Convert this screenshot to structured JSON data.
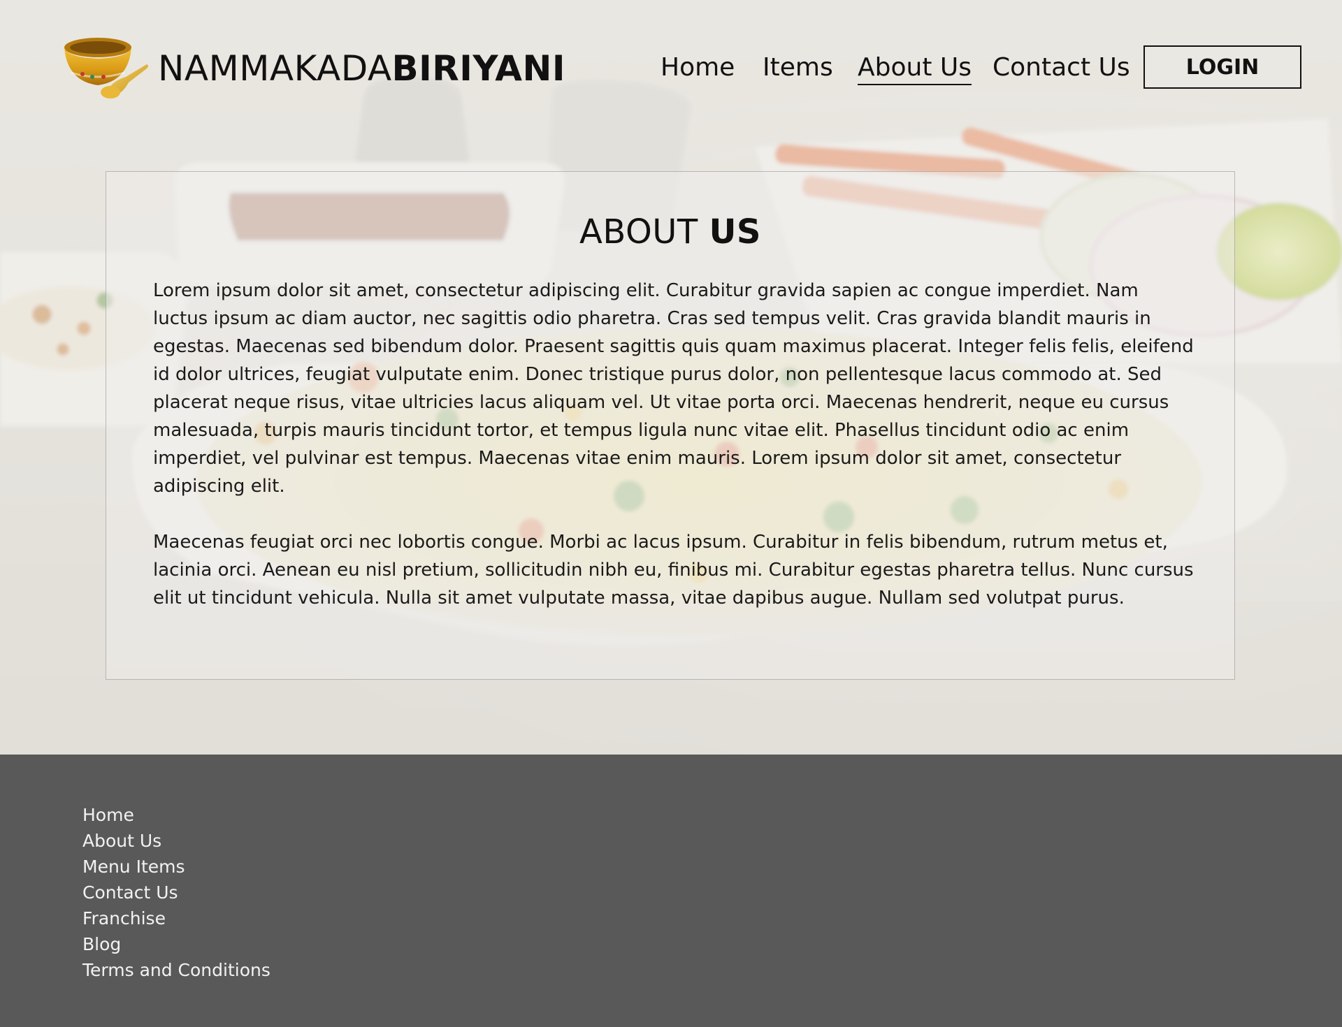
{
  "brand": {
    "name_light": "NAMMAKADA",
    "name_bold": "BIRIYANI",
    "logo_icon": "bowl-and-spoon-icon"
  },
  "nav": {
    "items": [
      {
        "label": "Home"
      },
      {
        "label": "Items"
      },
      {
        "label": "About Us",
        "active": true
      },
      {
        "label": "Contact Us"
      }
    ],
    "login_label": "LOGIN"
  },
  "about": {
    "title_light": "ABOUT ",
    "title_bold": "US",
    "paragraphs": [
      "Lorem ipsum dolor sit amet, consectetur adipiscing elit. Curabitur gravida sapien ac congue imperdiet. Nam luctus ipsum ac diam auctor, nec sagittis odio pharetra. Cras sed tempus velit. Cras gravida blandit mauris in egestas. Maecenas sed bibendum dolor. Praesent sagittis quis quam maximus placerat. Integer felis felis, eleifend id dolor ultrices, feugiat vulputate enim. Donec tristique purus dolor, non pellentesque lacus commodo at. Sed placerat neque risus, vitae ultricies lacus aliquam vel. Ut vitae porta orci. Maecenas hendrerit, neque eu cursus malesuada, turpis mauris tincidunt tortor, et tempus ligula nunc vitae elit. Phasellus tincidunt odio ac enim imperdiet, vel pulvinar est tempus. Maecenas vitae enim mauris. Lorem ipsum dolor sit amet, consectetur adipiscing elit.",
      "Maecenas feugiat orci nec lobortis congue. Morbi ac lacus ipsum. Curabitur in felis bibendum, rutrum metus et, lacinia orci. Aenean eu nisl pretium, sollicitudin nibh eu, finibus mi. Curabitur egestas pharetra tellus. Nunc cursus elit ut tincidunt vehicula. Nulla sit amet vulputate massa, vitae dapibus augue. Nullam sed volutpat purus."
    ]
  },
  "footer": {
    "links": [
      {
        "label": "Home"
      },
      {
        "label": "About Us"
      },
      {
        "label": "Menu Items"
      },
      {
        "label": "Contact Us"
      },
      {
        "label": "Franchise"
      },
      {
        "label": "Blog"
      },
      {
        "label": "Terms and Conditions"
      }
    ],
    "background": "#595959"
  },
  "colors": {
    "text": "#111111",
    "footer_text": "#f2f2f2"
  }
}
